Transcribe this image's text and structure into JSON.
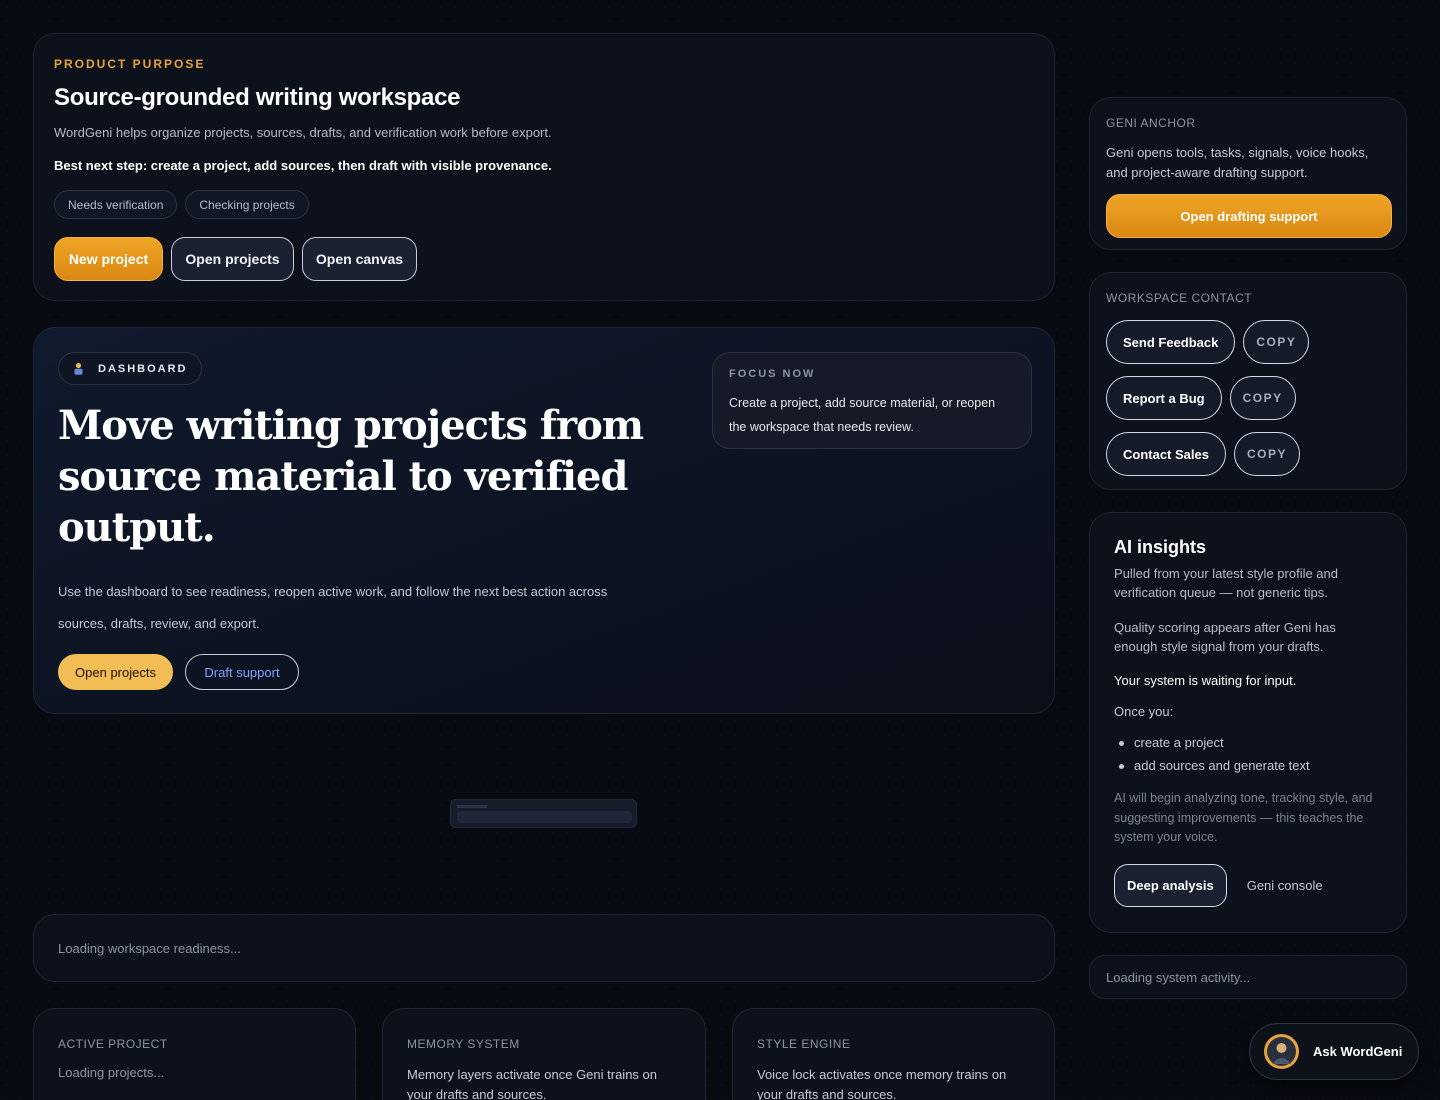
{
  "purpose": {
    "eyebrow": "PRODUCT PURPOSE",
    "title": "Source-grounded writing workspace",
    "description": "WordGeni helps organize projects, sources, drafts, and verification work before export.",
    "next_step": "Best next step: create a project, add sources, then draft with visible provenance.",
    "pills": [
      "Needs verification",
      "Checking projects"
    ],
    "buttons": {
      "new_project": "New project",
      "open_projects": "Open projects",
      "open_canvas": "Open canvas"
    }
  },
  "dashboard": {
    "badge": "DASHBOARD",
    "headline_lines": [
      "Move writing projects from",
      "source material to verified",
      "output."
    ],
    "body_line1": "Use the dashboard to see readiness, reopen active work, and follow the next best action across",
    "body_line2": "sources, drafts, review, and export.",
    "buttons": {
      "open_projects": "Open projects",
      "draft_support": "Draft support"
    },
    "focus": {
      "label": "FOCUS NOW",
      "text": "Create a project, add source material, or reopen the workspace that needs review."
    }
  },
  "readiness": {
    "loading": "Loading workspace readiness..."
  },
  "bottom_cards": [
    {
      "label": "ACTIVE PROJECT",
      "text": "Loading projects..."
    },
    {
      "label": "MEMORY SYSTEM",
      "text": "Memory layers activate once Geni trains on your drafts and sources."
    },
    {
      "label": "STYLE ENGINE",
      "text": "Voice lock activates once memory trains on your drafts and sources."
    }
  ],
  "anchor": {
    "label": "GENI ANCHOR",
    "text": "Geni opens tools, tasks, signals, voice hooks, and project-aware drafting support.",
    "button": "Open drafting support"
  },
  "contact": {
    "label": "WORKSPACE CONTACT",
    "rows": [
      {
        "action": "Send Feedback",
        "copy": "COPY"
      },
      {
        "action": "Report a Bug",
        "copy": "COPY"
      },
      {
        "action": "Contact Sales",
        "copy": "COPY"
      }
    ]
  },
  "insights": {
    "title": "AI insights",
    "subtitle": "Pulled from your latest style profile and verification queue — not generic tips.",
    "quality": "Quality scoring appears after Geni has enough style signal from your drafts.",
    "waiting": "Your system is waiting for input.",
    "once": "Once you:",
    "bullets": [
      "create a project",
      "add sources and generate text"
    ],
    "footer": "AI will begin analyzing tone, tracking style, and suggesting improvements — this teaches the system your voice.",
    "deep_analysis": "Deep analysis",
    "geni_console": "Geni console"
  },
  "activity": {
    "loading": "Loading system activity..."
  },
  "ask": {
    "label": "Ask WordGeni"
  },
  "colors": {
    "accent": "#e8a33a",
    "background": "#080b12",
    "card": "#0e121c",
    "link_blue": "#7ea6ff"
  }
}
